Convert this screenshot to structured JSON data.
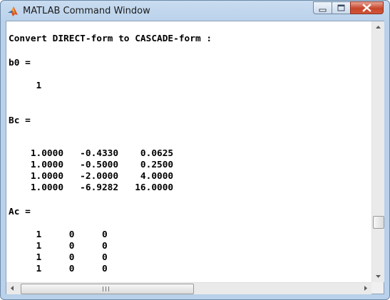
{
  "window": {
    "title": "MATLAB Command Window",
    "icon": "matlab-logo-icon",
    "controls": {
      "minimize": "minimize-icon",
      "maximize": "maximize-icon",
      "close": "close-icon"
    }
  },
  "console": {
    "lines": [
      "Convert DIRECT-form to CASCADE-form :",
      "b0 =",
      "     1",
      "Bc =",
      "    1.0000   -0.4330    0.0625",
      "    1.0000   -0.5000    0.2500",
      "    1.0000   -2.0000    4.0000",
      "    1.0000   -6.9282   16.0000",
      "Ac =",
      "     1     0     0",
      "     1     0     0",
      "     1     0     0",
      "     1     0     0"
    ]
  },
  "colors": {
    "frame": "#b9d1ea",
    "close_button": "#c7462b",
    "console_text": "#000000",
    "console_background": "#ffffff"
  }
}
